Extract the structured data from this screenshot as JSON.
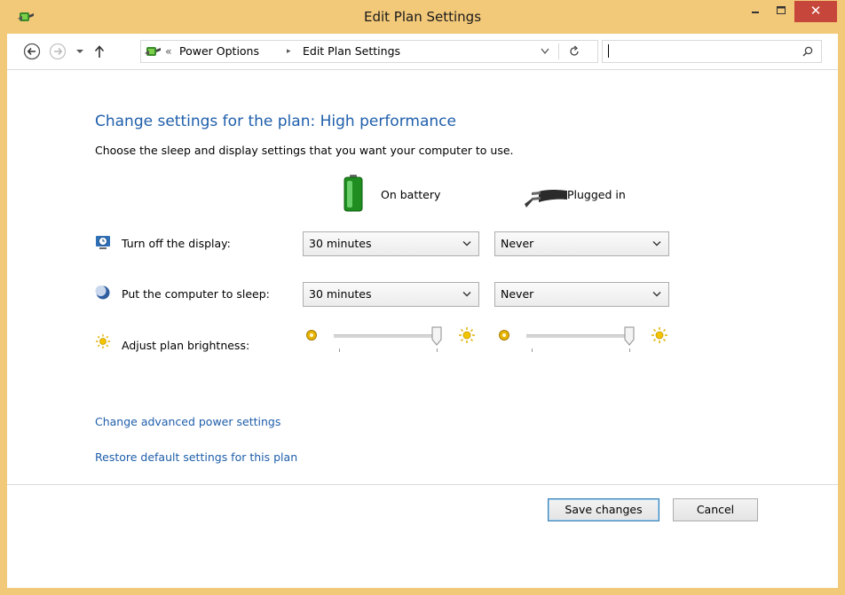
{
  "window": {
    "title": "Edit Plan Settings",
    "minimize_glyph": "‒",
    "close_glyph": "✕",
    "frame_color": "#f2c879"
  },
  "navigation": {
    "back_icon": "back-arrow-circle",
    "forward_icon": "forward-arrow-circle",
    "recent_icon": "chevron-down",
    "up_icon": "up-arrow",
    "breadcrumb_overflow": "«",
    "breadcrumbs": [
      "Power Options",
      "Edit Plan Settings"
    ],
    "breadcrumb_separator": "▸",
    "search_placeholder": ""
  },
  "main": {
    "heading": "Change settings for the plan: High performance",
    "subtext": "Choose the sleep and display settings that you want your computer to use.",
    "columns": {
      "battery_label": "On battery",
      "plugged_label": "Plugged in"
    },
    "rows": {
      "display_label": "Turn off the display:",
      "display_battery": "30 minutes",
      "display_plugged": "Never",
      "sleep_label": "Put the computer to sleep:",
      "sleep_battery": "30 minutes",
      "sleep_plugged": "Never",
      "brightness_label": "Adjust plan brightness:",
      "brightness_battery_level": 1.0,
      "brightness_plugged_level": 1.0
    },
    "links": {
      "advanced": "Change advanced power settings",
      "restore": "Restore default settings for this plan"
    }
  },
  "footer": {
    "save_label": "Save changes",
    "cancel_label": "Cancel"
  },
  "colors": {
    "link": "#1e5eaa",
    "close_button": "#c7463b"
  }
}
